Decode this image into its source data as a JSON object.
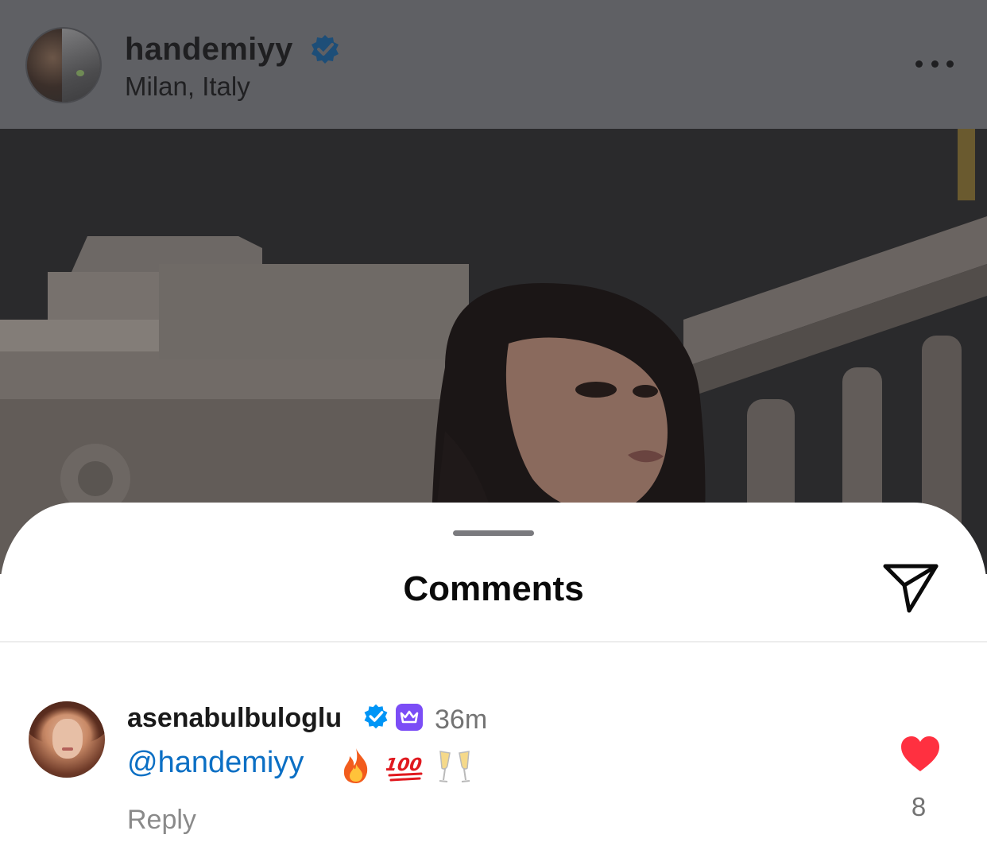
{
  "post": {
    "username": "handemiyy",
    "location": "Milan, Italy",
    "verified": true,
    "more_icon": "more-horizontal-icon"
  },
  "sheet": {
    "title": "Comments",
    "share_icon": "paper-plane-icon"
  },
  "comment": {
    "username": "asenabulbuloglu",
    "verified": true,
    "badge_icon": "crown-icon",
    "time": "36m",
    "mention": "@handemiyy",
    "emojis": [
      "fire-emoji",
      "hundred-points-emoji",
      "clinking-glasses-emoji"
    ],
    "reply_label": "Reply",
    "like_icon": "heart-filled-icon",
    "like_count": "8"
  },
  "colors": {
    "header_dim": "#5f6064",
    "verified_blue": "#0095f6",
    "crown_purple": "#7b4df6",
    "mention_blue": "#0b6fc4",
    "heart_red": "#ff3040",
    "muted_text": "#737373"
  }
}
